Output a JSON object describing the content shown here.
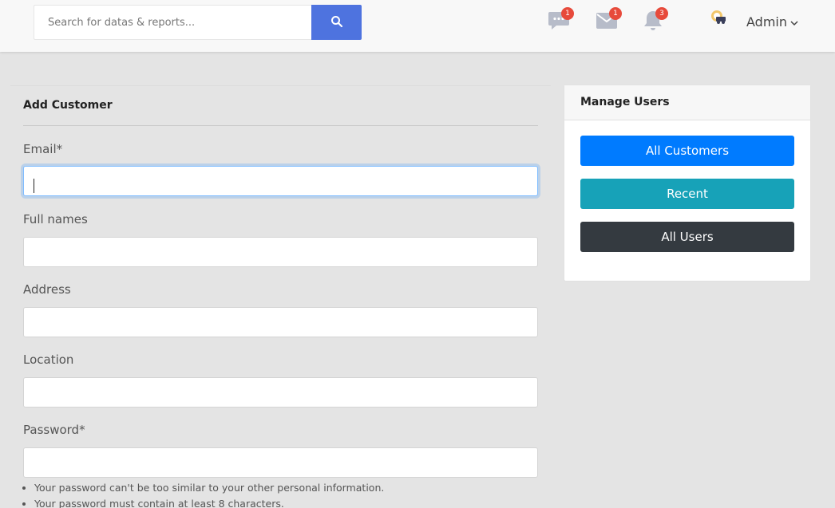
{
  "header": {
    "search": {
      "placeholder": "Search for datas & reports...",
      "value": ""
    },
    "messages_badge": "1",
    "mail_badge": "1",
    "alerts_badge": "3",
    "user_name": "Admin",
    "colors": {
      "search_button": "#4e73df",
      "badge": "#e74a3b",
      "icon": "#b7bcc9"
    }
  },
  "form": {
    "title": "Add Customer",
    "fields": [
      {
        "label": "Email*",
        "value": ""
      },
      {
        "label": "Full names",
        "value": ""
      },
      {
        "label": "Address",
        "value": ""
      },
      {
        "label": "Location",
        "value": ""
      },
      {
        "label": "Password*",
        "value": ""
      }
    ],
    "password_help": [
      "Your password can't be too similar to your other personal information.",
      "Your password must contain at least 8 characters."
    ]
  },
  "manage_users": {
    "title": "Manage Users",
    "buttons": [
      {
        "label": "All Customers",
        "color": "#007bff"
      },
      {
        "label": "Recent",
        "color": "#17a2b8"
      },
      {
        "label": "All Users",
        "color": "#343a40"
      }
    ]
  }
}
